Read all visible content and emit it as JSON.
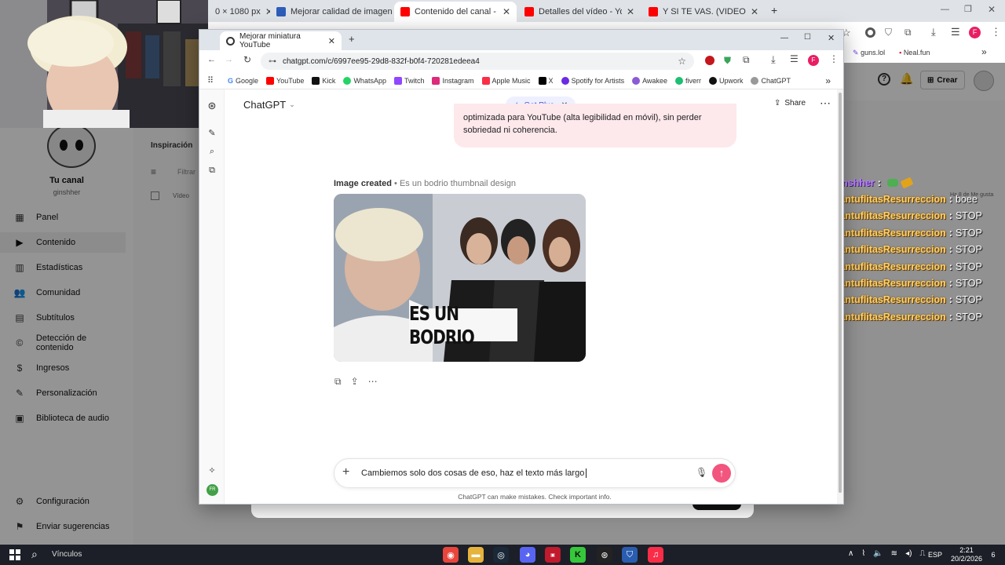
{
  "colors": {
    "gpt_accent": "#f2557d",
    "bubble_bg": "#fde8ec",
    "chat_username": "#ffd26a",
    "chat_badge": "#4db8ff"
  },
  "bg_browser": {
    "tabs": [
      {
        "title": "0 × 1080 px",
        "active": false
      },
      {
        "title": "Mejorar calidad de imagen onl",
        "active": false
      },
      {
        "title": "Contenido del canal - YouTube",
        "active": true
      },
      {
        "title": "Detalles del vídeo - YouTube St",
        "active": false
      },
      {
        "title": "Y SI TE VAS. (VIDEO OFICIAL) - ",
        "active": false
      }
    ],
    "bookmarks": [
      "guns.lol",
      "Neal.fun"
    ],
    "create_label": "Crear",
    "channel_title": "Tu canal",
    "channel_handle": "ginshher",
    "inspiration_tab": "Inspiración",
    "filter_placeholder": "Filtrar",
    "video_col": "Vídeo",
    "ago_text": "Ha 8 de Me gusta",
    "sidebar": [
      {
        "label": "Panel",
        "icon": "dashboard-icon"
      },
      {
        "label": "Contenido",
        "icon": "content-icon",
        "active": true
      },
      {
        "label": "Estadísticas",
        "icon": "analytics-icon"
      },
      {
        "label": "Comunidad",
        "icon": "community-icon"
      },
      {
        "label": "Subtítulos",
        "icon": "subtitles-icon"
      },
      {
        "label": "Detección de contenido",
        "icon": "copyright-icon"
      },
      {
        "label": "Ingresos",
        "icon": "money-icon"
      },
      {
        "label": "Personalización",
        "icon": "brush-icon"
      },
      {
        "label": "Biblioteca de audio",
        "icon": "audio-library-icon"
      }
    ],
    "footer_items": [
      {
        "label": "Configuración",
        "icon": "settings-icon"
      },
      {
        "label": "Enviar sugerencias",
        "icon": "feedback-icon"
      }
    ]
  },
  "gpt_window": {
    "tab_title": "Mejorar miniatura YouTube",
    "url": "chatgpt.com/c/6997ee95-29d8-832f-b0f4-720281edeea4",
    "bookmarks": [
      "Google",
      "YouTube",
      "Kick",
      "WhatsApp",
      "Twitch",
      "Instagram",
      "Apple Music",
      "X",
      "Spotify for Artists",
      "Awakee",
      "fiverr",
      "Upwork",
      "ChatGPT"
    ],
    "app_title": "ChatGPT",
    "get_plus": "Get Plus",
    "share": "Share",
    "user_msg_line1": "optimizada para YouTube (alta legibilidad en móvil), sin perder",
    "user_msg_line2": "sobriedad ni coherencia.",
    "image_created": "Image created",
    "image_desc": "• Es un bodrio thumbnail design",
    "thumb_text": "ES UN BODRIO",
    "composer_value": "Cambiemos solo dos cosas de eso, haz el texto más largo",
    "disclaimer": "ChatGPT can make mistakes. Check important info.",
    "avatar_initials": "FR"
  },
  "stream_chat": [
    {
      "user": "ginshher",
      "msg": "",
      "badge": "mic"
    },
    {
      "user": "PantuflitasResurreccion",
      "msg": "boee"
    },
    {
      "user": "PantuflitasResurreccion",
      "msg": "STOP"
    },
    {
      "user": "PantuflitasResurreccion",
      "msg": "STOP"
    },
    {
      "user": "PantuflitasResurreccion",
      "msg": "STOP"
    },
    {
      "user": "PantuflitasResurreccion",
      "msg": "STOP"
    },
    {
      "user": "PantuflitasResurreccion",
      "msg": "STOP"
    },
    {
      "user": "PantuflitasResurreccion",
      "msg": "STOP"
    },
    {
      "user": "PantuflitasResurreccion",
      "msg": "STOP"
    }
  ],
  "taskbar": {
    "search_label": "Vínculos",
    "lang": "ESP",
    "time": "2:21",
    "date": "20/2/2026",
    "notif_count": "6"
  }
}
